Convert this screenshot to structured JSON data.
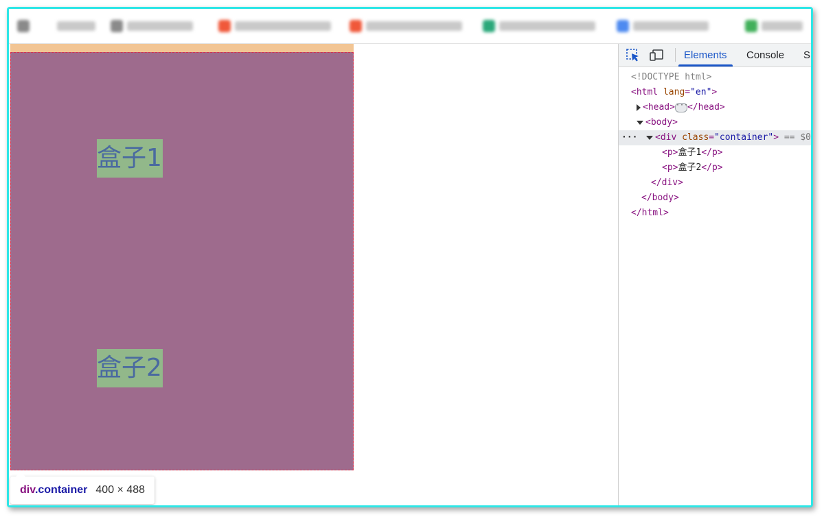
{
  "bookmarks": [
    {
      "icon": "blurred-icon",
      "color": "#888888"
    },
    {
      "icon": "blurred-icon",
      "color": "#888888"
    },
    {
      "icon": "blurred-favicon",
      "color": "#f0583a"
    },
    {
      "icon": "blurred-favicon",
      "color": "#f0583a"
    },
    {
      "icon": "blurred-favicon",
      "color": "#2aa87a"
    },
    {
      "icon": "blurred-favicon",
      "color": "#4d8af0"
    },
    {
      "icon": "blurred-favicon",
      "color": "#41b05a"
    }
  ],
  "page": {
    "box1": "盒子1",
    "box2": "盒子2",
    "colors": {
      "container_bg": "#9e6b8d",
      "margin": "#f2c594",
      "box_bg": "#92b88a",
      "box_text": "#4a6aa0"
    }
  },
  "tooltip": {
    "tag": "div",
    "cls": ".container",
    "size": "400 × 488"
  },
  "devtools": {
    "tabs": [
      "Elements",
      "Console",
      "S"
    ],
    "active_tab": "Elements",
    "tree": {
      "doctype": "<!DOCTYPE html>",
      "html_open": "<html",
      "lang_attr": "lang",
      "lang_val": "\"en\"",
      "close_gt": ">",
      "head_open": "<head>",
      "head_close": "</head>",
      "body_open": "<body>",
      "div_open": "<div",
      "class_attr": "class",
      "class_val": "\"container\"",
      "eq_sign": "== $0",
      "p_open": "<p>",
      "p_close": "</p>",
      "p1_text": "盒子1",
      "p2_text": "盒子2",
      "div_close": "</div>",
      "body_close": "</body>",
      "html_close": "</html>",
      "row_dots": "···"
    }
  }
}
